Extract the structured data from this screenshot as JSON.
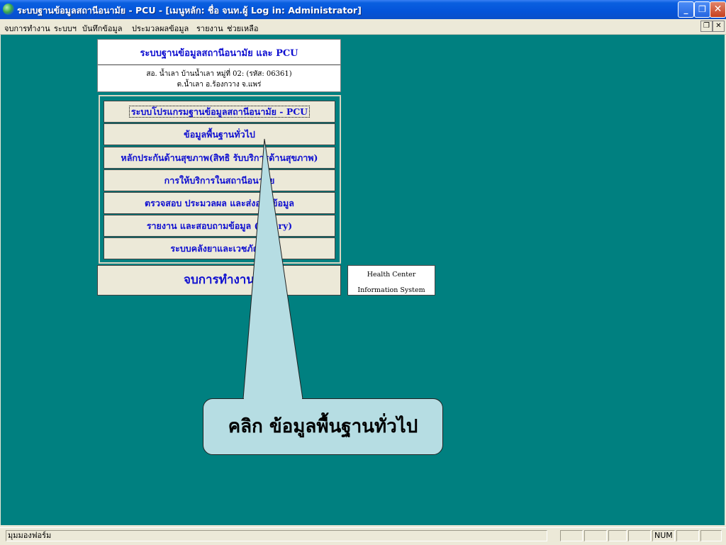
{
  "window": {
    "title": "ระบบฐานข้อมูลสถานีอนามัย - PCU - [เมนูหลัก: ชื่อ จนท.ผู้ Log in: Administrator]",
    "minimize_glyph": "_",
    "restore_glyph": "❐",
    "close_glyph": "✕"
  },
  "menubar": {
    "items": [
      "จบการทำงาน",
      "ระบบฯ",
      "บันทึกข้อมูล",
      "ประมวลผลข้อมูล",
      "รายงาน",
      "ช่วยเหลือ"
    ],
    "restore_glyph": "❐",
    "close_glyph": "✕"
  },
  "header": {
    "title": "ระบบฐานข้อมูลสถานีอนามัย และ PCU",
    "line1": "สอ. น้ำเลา บ้านน้ำเลา หมู่ที่ 02: (รหัส: 06361)",
    "line2": "ต.น้ำเลา อ.ร้องกวาง จ.แพร่"
  },
  "menu": {
    "buttons": [
      "ระบบโปรแกรมฐานข้อมูลสถานีอนามัย - PCU",
      "ข้อมูลพื้นฐานทั่วไป",
      "หลักประกันด้านสุขภาพ(สิทธิ รับบริการด้านสุขภาพ)",
      "การให้บริการในสถานีอนามัย",
      "ตรวจสอบ ประมวลผล และส่งออกข้อมูล",
      "รายงาน และสอบถามข้อมูล (Query)",
      "ระบบคลังยาและเวชภัณฑ์"
    ],
    "exit": "จบการทำงาน"
  },
  "info_box": {
    "line1": "Health Center",
    "line2": "Information System"
  },
  "callout": {
    "text": "คลิก ข้อมูลพื้นฐานทั่วไป"
  },
  "statusbar": {
    "left_text": "มุมมองฟอร์ม",
    "num_indicator": "NUM"
  },
  "colors": {
    "workspace": "#008080",
    "button_text": "#1010d0",
    "callout_fill": "#b6dde3"
  }
}
